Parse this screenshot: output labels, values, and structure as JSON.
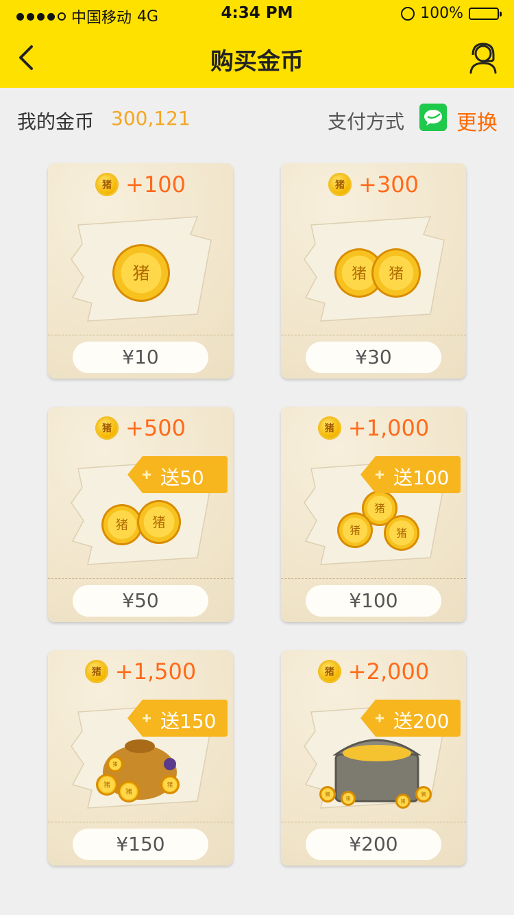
{
  "status_bar": {
    "carrier": "中国移动",
    "network": "4G",
    "time": "4:34 PM",
    "battery": "100%"
  },
  "nav": {
    "title": "购买金币"
  },
  "info": {
    "my_coins_label": "我的金币",
    "my_coins_value": "300,121",
    "payment_label": "支付方式",
    "change_label": "更换"
  },
  "coin_glyph": "猪",
  "packages": [
    {
      "amount": "+100",
      "price": "¥10",
      "bonus": ""
    },
    {
      "amount": "+300",
      "price": "¥30",
      "bonus": ""
    },
    {
      "amount": "+500",
      "price": "¥50",
      "bonus": "送50"
    },
    {
      "amount": "+1,000",
      "price": "¥100",
      "bonus": "送100"
    },
    {
      "amount": "+1,500",
      "price": "¥150",
      "bonus": "送150"
    },
    {
      "amount": "+2,000",
      "price": "¥200",
      "bonus": "送200"
    }
  ],
  "colors": {
    "brand_yellow": "#ffe100",
    "accent_orange": "#ff6a00",
    "coin_gold": "#f5b700",
    "wechat_green": "#1ec94b"
  }
}
